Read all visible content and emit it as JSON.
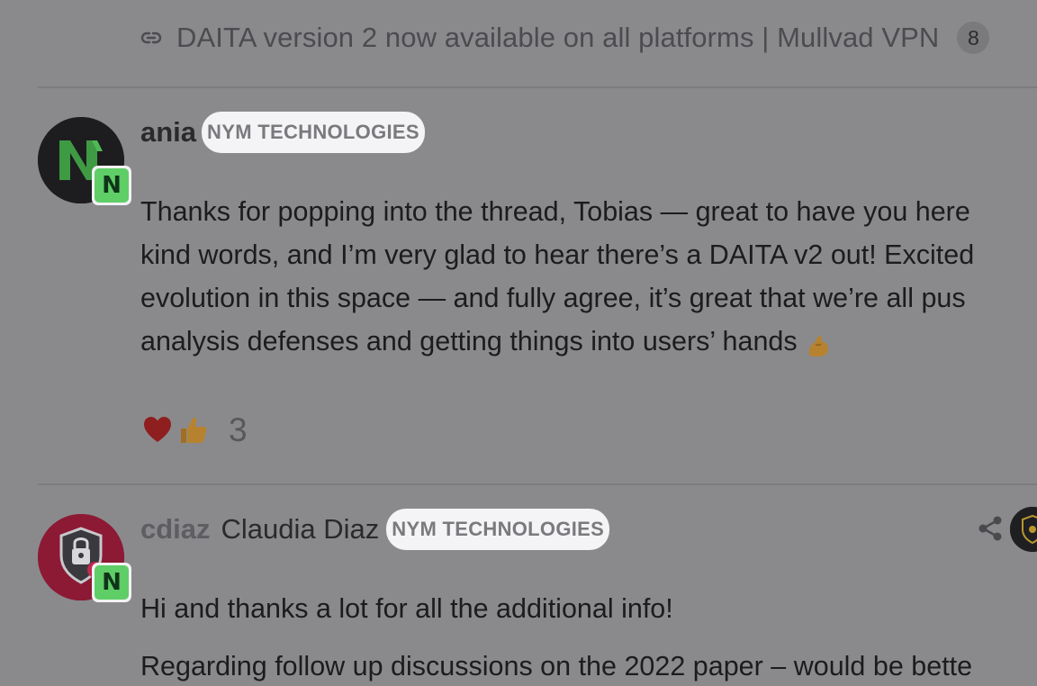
{
  "topic_link": {
    "icon": "link-icon",
    "title": "DAITA version 2 now available on all platforms | Mullvad VPN",
    "click_count": "8"
  },
  "posts": [
    {
      "username": "ania",
      "full_name": "",
      "group": "NYM TECHNOLOGIES",
      "flair_letter": "N",
      "paragraphs": [
        "Thanks for popping into the thread, Tobias — great to have you here",
        "kind words, and I’m very glad to hear there’s a DAITA v2 out! Excited",
        "evolution in this space — and fully agree, it’s great that we’re all pus",
        "analysis defenses and getting things into users’ hands"
      ],
      "trailing_emoji": "flexed-biceps-emoji",
      "reactions": {
        "emojis": [
          "heart-emoji",
          "thumbs-up-emoji"
        ],
        "count": "3"
      }
    },
    {
      "username": "cdiaz",
      "full_name": "Claudia Diaz",
      "group": "NYM TECHNOLOGIES",
      "flair_letter": "N",
      "paragraphs": [
        "Hi and thanks a lot for all the additional info!",
        "Regarding follow up discussions on the 2022 paper – would be bette"
      ]
    }
  ],
  "colors": {
    "background_overlay": "#8a8a8d",
    "flair_green": "#5fce67",
    "badge_bg": "#f4f4f6",
    "avatar_ania_bg": "#1d1d1f",
    "avatar_cdiaz_bg": "#8c1a34"
  }
}
